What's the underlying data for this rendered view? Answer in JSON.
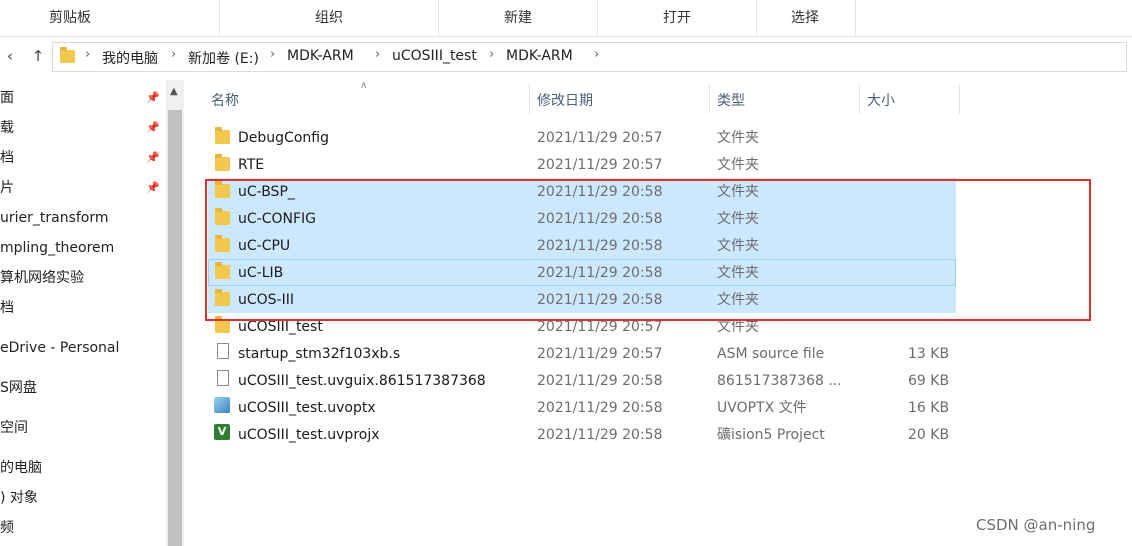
{
  "ribbon": {
    "groups": [
      "剪贴板",
      "组织",
      "新建",
      "打开",
      "选择"
    ]
  },
  "address": {
    "back_icon": "arrow-back-icon",
    "up_icon": "arrow-up-icon",
    "crumbs": [
      "我的电脑",
      "新加卷 (E:)",
      "MDK-ARM",
      "uCOSIII_test",
      "MDK-ARM"
    ],
    "separator": "›"
  },
  "leftnav": {
    "items": [
      "面",
      "载",
      "档",
      "片",
      "urier_transform",
      "mpling_theorem",
      "算机网络实验",
      "档",
      "eDrive - Personal",
      "S网盘",
      "空间",
      "的电脑",
      ") 对象",
      "频"
    ],
    "pin_icon": "📌"
  },
  "columns": {
    "name": "名称",
    "date": "修改日期",
    "type": "类型",
    "size": "大小"
  },
  "files": [
    {
      "name": "DebugConfig",
      "date": "2021/11/29 20:57",
      "type": "文件夹",
      "size": "",
      "icon": "folder-icon"
    },
    {
      "name": "RTE",
      "date": "2021/11/29 20:57",
      "type": "文件夹",
      "size": "",
      "icon": "folder-icon"
    },
    {
      "name": "uC-BSP_",
      "date": "2021/11/29 20:58",
      "type": "文件夹",
      "size": "",
      "icon": "folder-icon"
    },
    {
      "name": "uC-CONFIG",
      "date": "2021/11/29 20:58",
      "type": "文件夹",
      "size": "",
      "icon": "folder-icon"
    },
    {
      "name": "uC-CPU",
      "date": "2021/11/29 20:58",
      "type": "文件夹",
      "size": "",
      "icon": "folder-icon"
    },
    {
      "name": "uC-LIB",
      "date": "2021/11/29 20:58",
      "type": "文件夹",
      "size": "",
      "icon": "folder-icon"
    },
    {
      "name": "uCOS-III",
      "date": "2021/11/29 20:58",
      "type": "文件夹",
      "size": "",
      "icon": "folder-icon"
    },
    {
      "name": "uCOSIII_test",
      "date": "2021/11/29 20:57",
      "type": "文件夹",
      "size": "",
      "icon": "folder-icon"
    },
    {
      "name": "startup_stm32f103xb.s",
      "date": "2021/11/29 20:57",
      "type": "ASM source file",
      "size": "13 KB",
      "icon": "file-icon"
    },
    {
      "name": "uCOSIII_test.uvguix.861517387368",
      "date": "2021/11/29 20:58",
      "type": "861517387368 ...",
      "size": "69 KB",
      "icon": "file-icon"
    },
    {
      "name": "uCOSIII_test.uvoptx",
      "date": "2021/11/29 20:58",
      "type": "UVOPTX 文件",
      "size": "16 KB",
      "icon": "uvoptx-icon"
    },
    {
      "name": "uCOSIII_test.uvprojx",
      "date": "2021/11/29 20:58",
      "type": "礦ision5 Project",
      "size": "20 KB",
      "icon": "uvprojx-icon"
    }
  ],
  "proj_icon_glyph": "V",
  "watermark": "CSDN @an-ning",
  "colors": {
    "selection": "#cce8ff",
    "highlight_box": "#e0302e",
    "folder": "#f3c851"
  }
}
